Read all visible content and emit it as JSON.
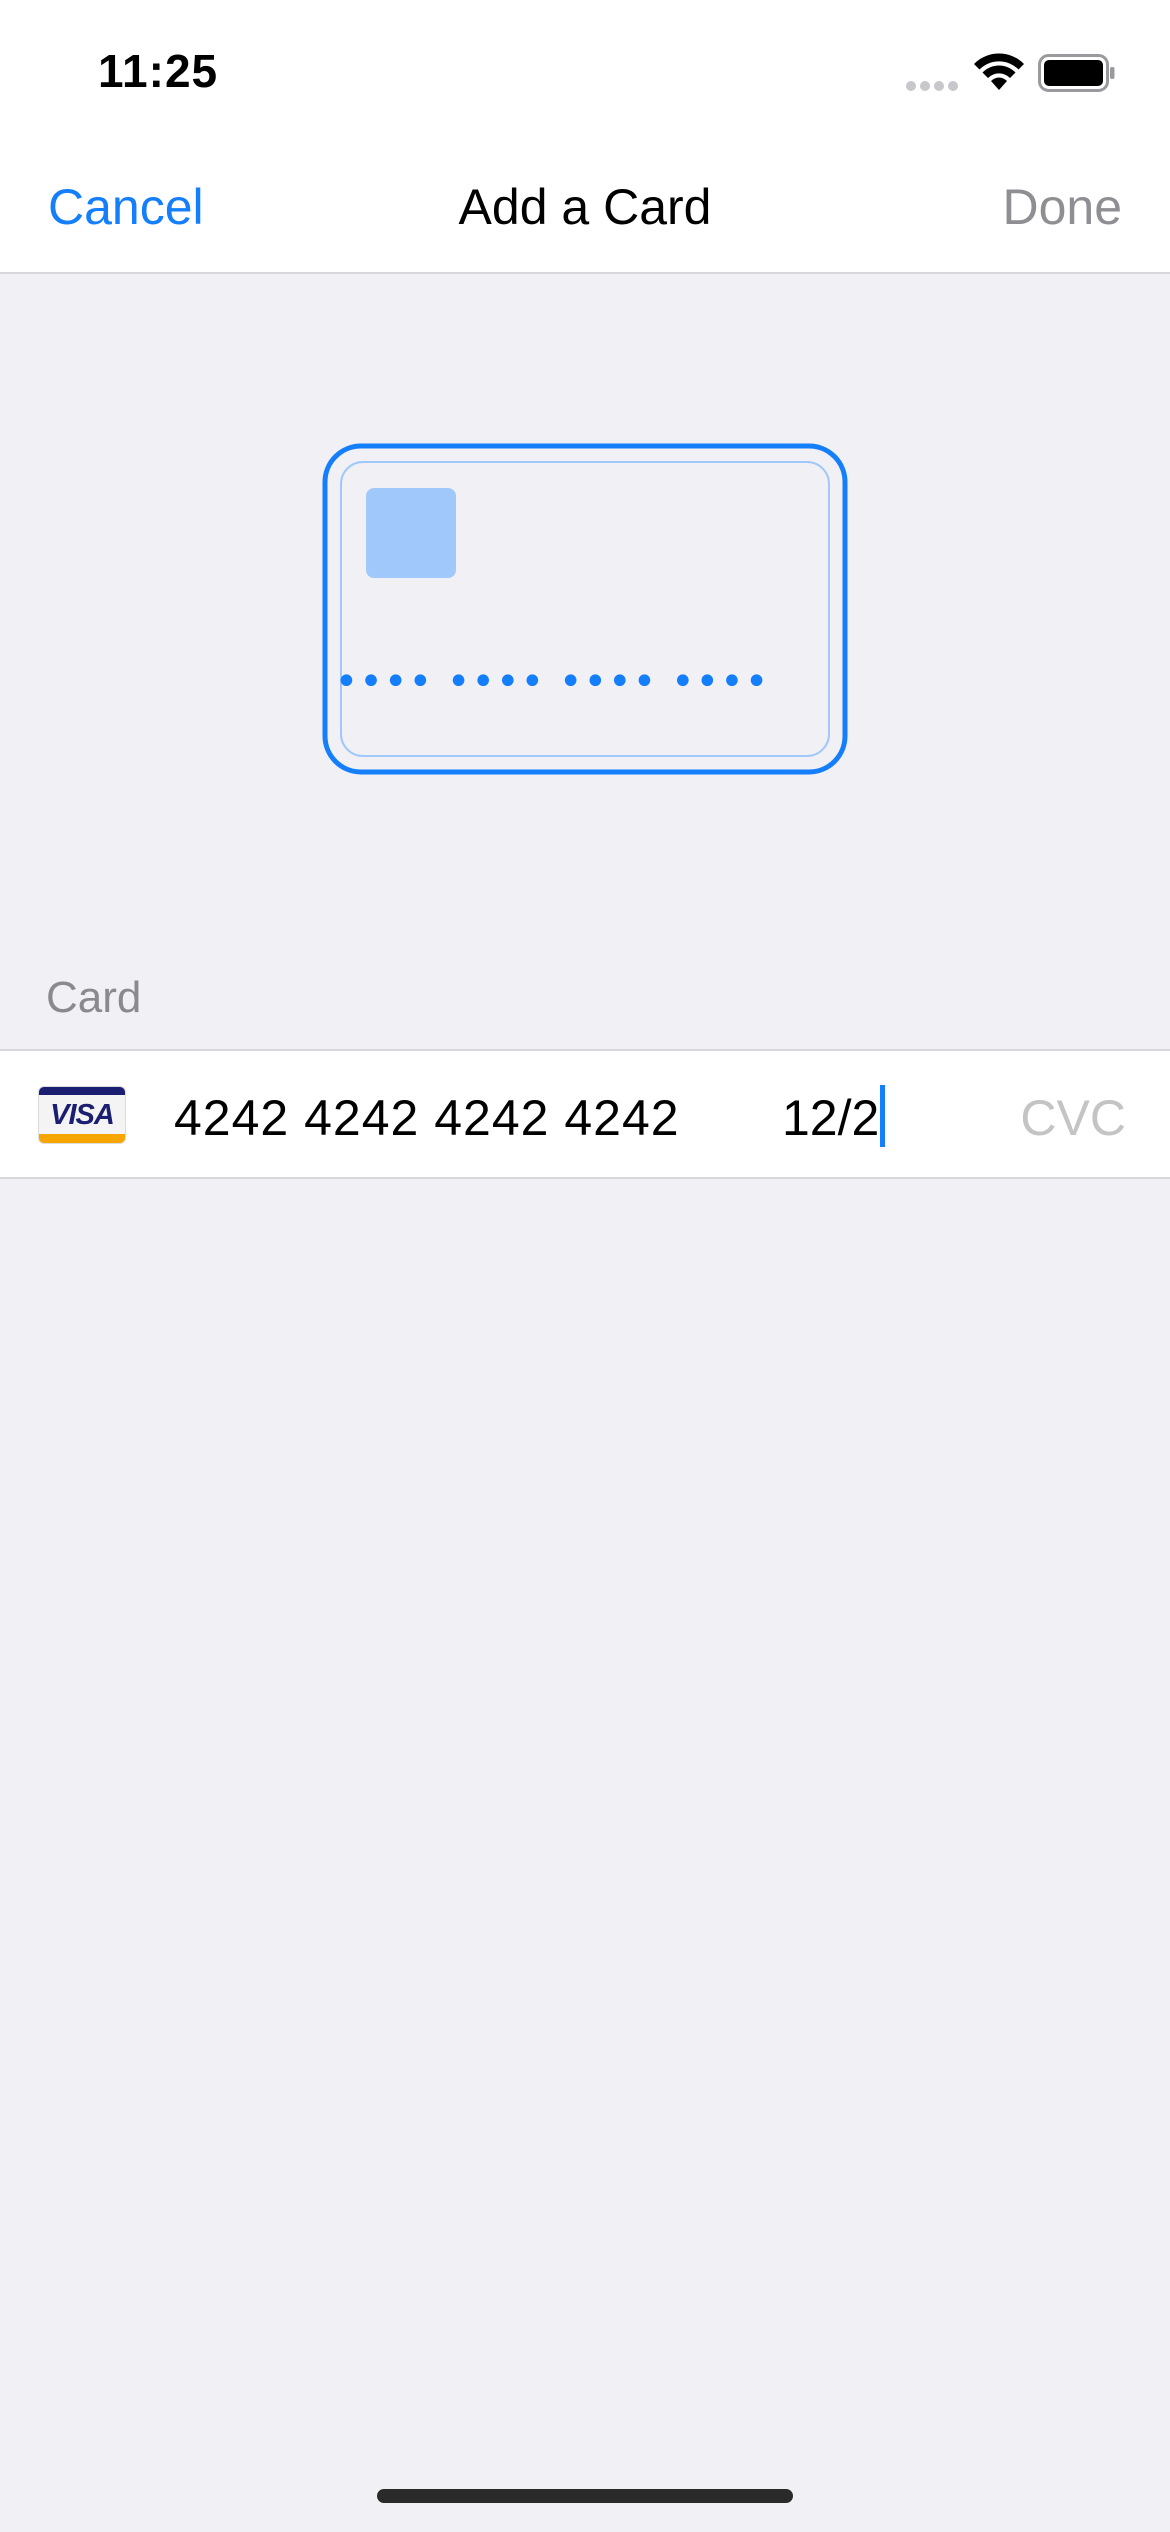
{
  "status_bar": {
    "time": "11:25"
  },
  "nav": {
    "cancel_label": "Cancel",
    "title": "Add a Card",
    "done_label": "Done"
  },
  "card_illustration": {
    "masked_number": "•••• •••• •••• ••••"
  },
  "section": {
    "header": "Card"
  },
  "card_input": {
    "brand_label": "VISA",
    "number_value": "4242 4242 4242 4242",
    "expiry_value": "12/2",
    "cvc_placeholder": "CVC"
  },
  "colors": {
    "accent": "#147efb",
    "card_chip": "#a0c8fa",
    "background": "#f0f0f5",
    "disabled_text": "#8e8e93",
    "placeholder_text": "#c4c4c7"
  },
  "icons": {
    "wifi": "wifi-icon",
    "battery": "battery-icon",
    "signal": "cellular-signal-icon",
    "card_brand": "visa-icon"
  }
}
